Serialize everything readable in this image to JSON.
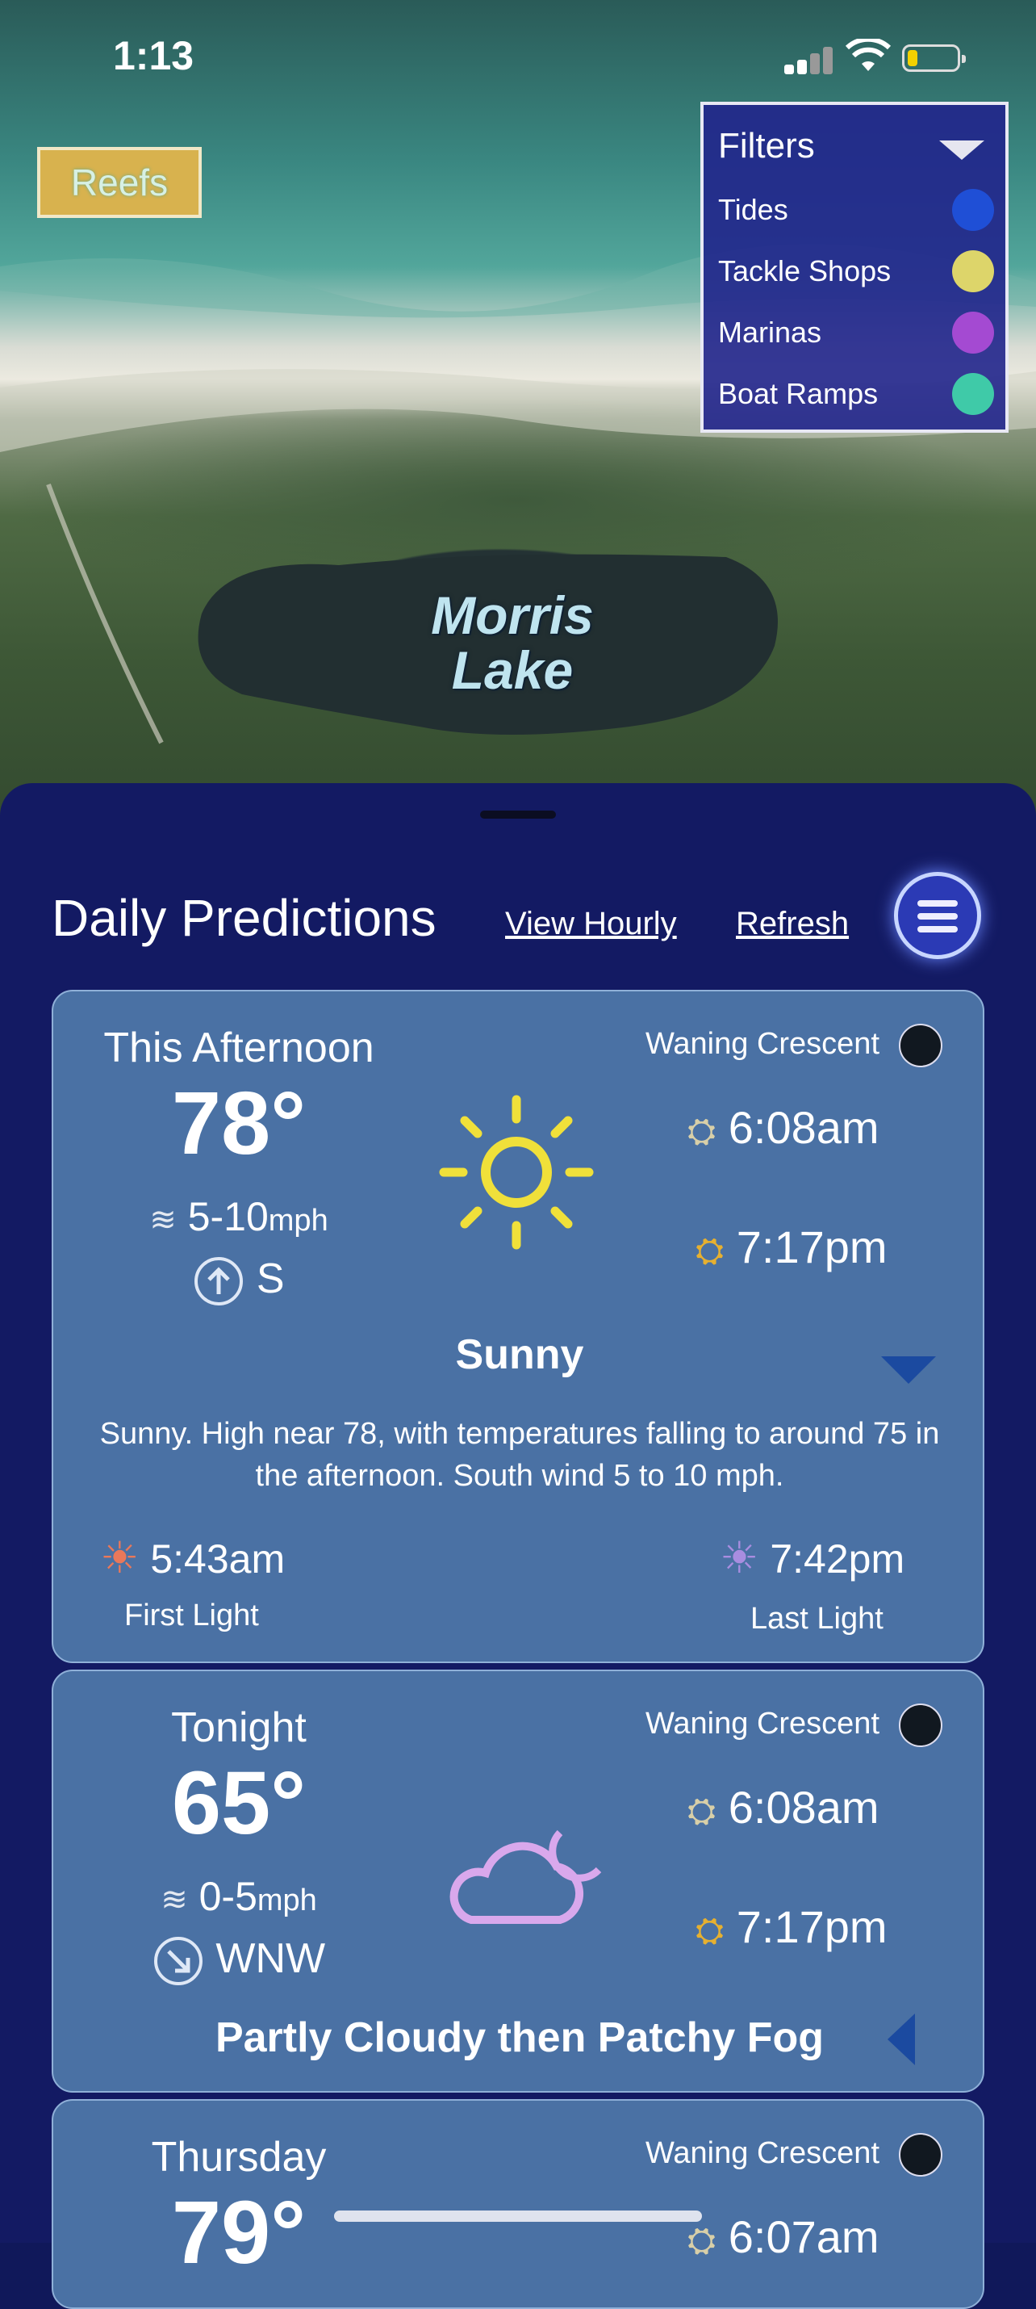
{
  "status_bar": {
    "time": "1:13"
  },
  "map": {
    "reefs_button": "Reefs",
    "lake_label_line1": "Morris",
    "lake_label_line2": "Lake",
    "filters": {
      "title": "Filters",
      "items": [
        {
          "label": "Tides",
          "color": "#1f4fd6"
        },
        {
          "label": "Tackle Shops",
          "color": "#ddd56a"
        },
        {
          "label": "Marinas",
          "color": "#a44ad2"
        },
        {
          "label": "Boat Ramps",
          "color": "#3fcaa8"
        }
      ]
    }
  },
  "sheet": {
    "title": "Daily Predictions",
    "view_hourly": "View Hourly",
    "refresh": "Refresh",
    "cards": [
      {
        "title": "This Afternoon",
        "temp": "78°",
        "wind": "5-10",
        "wind_unit": "mph",
        "direction": "S",
        "moon_phase": "Waning Crescent",
        "moonrise": "6:08am",
        "moonset": "7:17pm",
        "condition": "Sunny",
        "icon": "sun-icon",
        "description": "Sunny. High near 78, with temperatures falling to around 75 in the afternoon. South wind 5 to 10 mph.",
        "first_light_time": "5:43am",
        "first_light_label": "First Light",
        "last_light_time": "7:42pm",
        "last_light_label": "Last Light"
      },
      {
        "title": "Tonight",
        "temp": "65°",
        "wind": "0-5",
        "wind_unit": "mph",
        "direction": "WNW",
        "moon_phase": "Waning Crescent",
        "moonrise": "6:08am",
        "moonset": "7:17pm",
        "condition": "Partly Cloudy then Patchy Fog",
        "icon": "cloud-moon-icon"
      },
      {
        "title": "Thursday",
        "temp": "79°",
        "moon_phase": "Waning Crescent",
        "moonrise": "6:07am"
      }
    ]
  }
}
